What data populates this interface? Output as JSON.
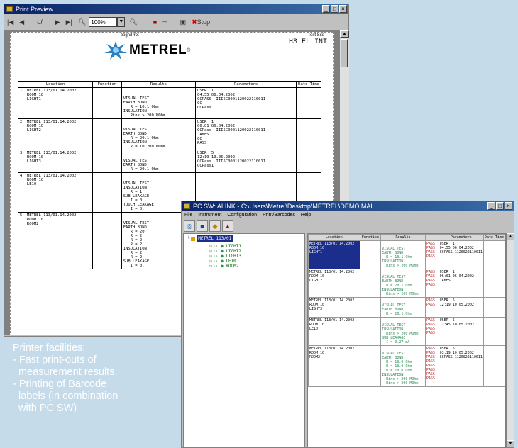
{
  "print_preview": {
    "title": "Print Preview",
    "nav_first": "|◀",
    "nav_prev": "◀",
    "nav_page": "of",
    "nav_next": "▶",
    "nav_last": "▶|",
    "zoom_value": "100%",
    "stop_label": "Stop",
    "header_left": "Sign/Prot",
    "header_right_label": "Test Site",
    "header_right_value": "HS EL INT",
    "brand": "METREL",
    "columns": [
      "Location",
      "Function",
      "Results",
      "Parameters",
      "Date Time"
    ],
    "rows": [
      {
        "loc": "1  METREL 113/01.14.2002\n   ROOM 10\n   LIGHT1",
        "results": "VISUAL TEST\nEARTH BOND\n   R = 10.1 Ohm\nINSULATION\n   Rins > 200 MOhm",
        "params": "USER  1\n04.55 06.04.2002\nCCPASS  III5C0001120022110011\nCC\nCCPass"
      },
      {
        "loc": "2  METREL 113/01.14.2002\n   ROOM 10\n   LIGHT2",
        "results": "VISUAL TEST\nEARTH BOND\n   R = 20.1 Ohm\nINSULATION\n   R = 10 200 MOhm",
        "params": "USER  1\n06:01 06.04.2002\nCCPass  III5C0001120022110011\nJAMES\nCC\nPASS"
      },
      {
        "loc": "3  METREL 113/01.14.2002\n   ROOM 10\n   LIGHT3",
        "results": "VISUAL TEST\nEARTH BOND\n   R = 20.1 Ohm",
        "params": "USER  5\n12:19 10.05.2002\nCCPass  III5C0001120022110011\nCCPass1"
      },
      {
        "loc": "4  METREL 113/01.14.2002\n   ROOM 10\n   LE10",
        "results": "VISUAL TEST\nINSULATION\n   R = 1\nSUB LEAKAGE\n   I = 0.\nTOUCH LEAKAGE\n   I = 0.",
        "params": ""
      },
      {
        "loc": "5  METREL 113/01.14.2002\n   ROOM 10\n   ROOM2",
        "results": "VISUAL TEST\nEARTH BOND\n   R = 20\n   R = 2\n   R = 2\n   R = 2\nINSULATION\n   R = 2\n   R = 2\nSUB LEAKAGE\n   I = 0.",
        "params": ""
      }
    ]
  },
  "pcsw": {
    "title": "PC SW: ALINK - C:\\Users\\Metrel\\Desktop\\METREL\\DEMO.MAL",
    "menu": [
      "File",
      "Instrument",
      "Configuration",
      "Print/Barcodes",
      "Help"
    ],
    "tree_root": "METREL 113/01",
    "tree_items": [
      "LIGHT1",
      "LIGHT2",
      "LIGHT3",
      "LE10",
      "ROOM2"
    ],
    "columns": [
      "Location",
      "Function",
      "Results",
      "Parameters",
      "Date Time"
    ],
    "rows": [
      {
        "loc": "METREL 113/01.14.2002\nROOM 10\nLIGHT1",
        "results": "VISUAL TEST\nEARTH BOND\n  R = 10.1 Ohm\nINSULATION\n  Rins > 200 MOhm",
        "pass": "PASS\nPASS\nPASS\nPASS",
        "params": "USER  1\n04.55 06.04.2002\nCCPASS 1120022110011"
      },
      {
        "loc": "METREL 113/01.14.2002\nROOM 10\nLIGHT2",
        "results": "VISUAL TEST\nEARTH BOND\n  R = 20.1 Ohm\nINSULATION\n  Rins > 200 MOhm",
        "pass": "PASS\nPASS\nPASS\nPASS",
        "params": "USER  1\n06:01 06.04.2002\nJAMES"
      },
      {
        "loc": "METREL 113/01.14.2002\nROOM 10\nLIGHT3",
        "results": "VISUAL TEST\nEARTH BOND\n  R = 20.1 Ohm",
        "pass": "PASS\nPASS",
        "params": "USER  5\n12:19 10.05.2002"
      },
      {
        "loc": "METREL 113/01.14.2002\nROOM 10\nLE10",
        "results": "VISUAL TEST\nINSULATION\n  Rins > 200 MOhm\nSUB LEAKAGE\n  I = 0.27 mA",
        "pass": "PASS\nPASS\nPASS\nPASS",
        "params": "USER  5\n12:45 10.05.2002"
      },
      {
        "loc": "METREL 113/01.14.2002\nROOM 10\nROOM2",
        "results": "VISUAL TEST\nEARTH BOND\n  R = 10.0 Ohm\n  R = 10.0 Ohm\n  R = 10.0 Ohm\nINSULATION\n  Rins > 200 MOhm\n  Rins > 200 MOhm",
        "pass": "PASS\nPASS\nPASS\nPASS\nPASS\nPASS\nPASS\nPASS",
        "params": "USER  5\n03.19 10.05.2002\nCCPASS 1120022110011"
      }
    ]
  },
  "caption": {
    "heading": "Printer facilities:",
    "lines": [
      "- Fast print-outs of",
      "  measurement results.",
      "- Printing of Barcode",
      "  labels (in combination",
      "  with PC SW)"
    ]
  },
  "colors": {
    "background": "#c5dbea",
    "titlebar": "#0a246a",
    "selection": "#1c2e8c"
  }
}
